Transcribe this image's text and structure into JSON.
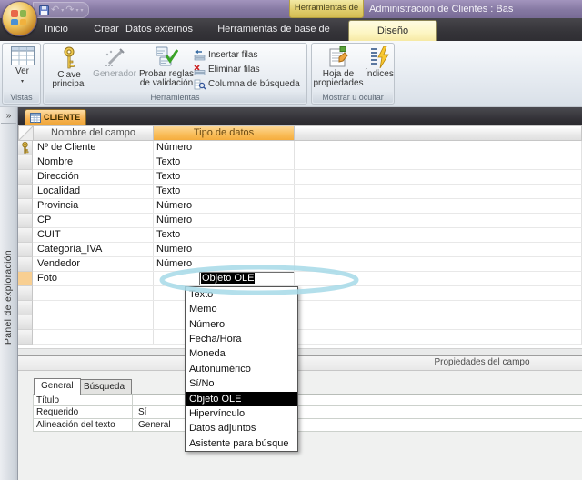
{
  "colors": {
    "titlebar": "#8578a2",
    "ribbon_tab_bar": "#353439",
    "active_tab_bg": "#fdf6c3",
    "contextual_header_bg": "#e0cc6b",
    "doc_tab_orange": "#f6b355",
    "type_header_orange": "#f9bc58",
    "selection_bg": "#000000",
    "annotation_stroke": "#a6d9e8"
  },
  "glyphs": {
    "caret_down": "▾",
    "combo_arrow": "▼",
    "nav_collapse": "»",
    "undo": "↶",
    "redo": "↷",
    "qat_more": "▾"
  },
  "titlebar": {
    "contextual_group": "Herramientas de tabla",
    "window_title": "Administración de Clientes : Bas",
    "icons": {
      "office_logo": "office-flower",
      "save": "floppy-disk",
      "undo": "undo-arrow",
      "redo": "redo-arrow"
    }
  },
  "ribbon": {
    "tabs": [
      "Inicio",
      "Crear",
      "Datos externos",
      "Herramientas de base de datos"
    ],
    "active_tab": "Diseño",
    "groups": [
      {
        "label": "Vistas",
        "buttons": [
          {
            "label": "Ver",
            "icon": "table-view",
            "dropdown": true
          }
        ]
      },
      {
        "label": "Herramientas",
        "buttons": [
          {
            "label": "Clave principal",
            "icon": "primary-key"
          },
          {
            "label": "Generador",
            "icon": "builder-wand",
            "disabled": true
          },
          {
            "label": "Probar reglas de validación",
            "icon": "validation-check"
          }
        ],
        "small_buttons": [
          {
            "label": "Insertar filas",
            "icon": "insert-rows"
          },
          {
            "label": "Eliminar filas",
            "icon": "delete-rows"
          },
          {
            "label": "Columna de búsqueda",
            "icon": "lookup-column"
          }
        ]
      },
      {
        "label": "Mostrar u ocultar",
        "buttons": [
          {
            "label": "Hoja de propiedades",
            "icon": "property-sheet"
          },
          {
            "label": "Índices",
            "icon": "indexes-lightning"
          }
        ]
      }
    ]
  },
  "nav_pane": {
    "collapse_glyph": "»",
    "label": "Panel de exploración"
  },
  "document": {
    "tab_label": "CLIENTE",
    "grid": {
      "headers": [
        "Nombre del campo",
        "Tipo de datos"
      ],
      "rows": [
        {
          "name": "Nº de Cliente",
          "type": "Número",
          "primary_key": true
        },
        {
          "name": "Nombre",
          "type": "Texto"
        },
        {
          "name": "Dirección",
          "type": "Texto"
        },
        {
          "name": "Localidad",
          "type": "Texto"
        },
        {
          "name": "Provincia",
          "type": "Número"
        },
        {
          "name": "CP",
          "type": "Número"
        },
        {
          "name": "CUIT",
          "type": "Texto"
        },
        {
          "name": "Categoría_IVA",
          "type": "Número"
        },
        {
          "name": "Vendedor",
          "type": "Número"
        },
        {
          "name": "Foto",
          "type": "Objeto OLE",
          "selected": true
        }
      ]
    },
    "type_dropdown": {
      "value": "Objeto OLE",
      "highlighted": "Objeto OLE",
      "arrow_glyph": "▼",
      "options": [
        "Texto",
        "Memo",
        "Número",
        "Fecha/Hora",
        "Moneda",
        "Autonumérico",
        "Sí/No",
        "Objeto OLE",
        "Hipervínculo",
        "Datos adjuntos",
        "Asistente para búsque"
      ]
    },
    "field_properties": {
      "caption": "Propiedades del campo",
      "tabs": [
        "General",
        "Búsqueda"
      ],
      "active_tab": "General",
      "rows": [
        {
          "label": "Título",
          "value": ""
        },
        {
          "label": "Requerido",
          "value": "Sí"
        },
        {
          "label": "Alineación del texto",
          "value": "General"
        }
      ]
    }
  }
}
